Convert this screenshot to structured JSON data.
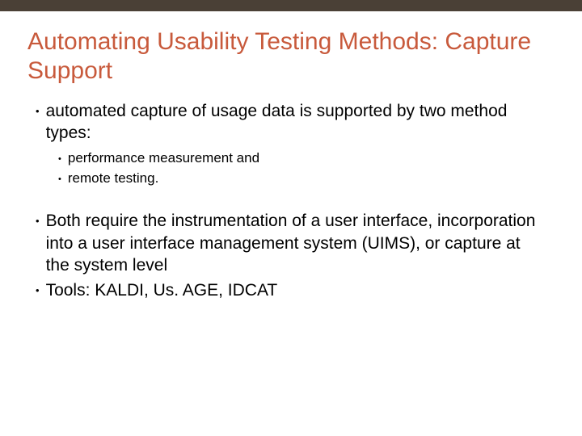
{
  "title": "Automating Usability Testing Methods: Capture Support",
  "bullets": {
    "b1": "automated capture of usage data is supported by two method types:",
    "b1a": "performance measurement and",
    "b1b": "remote testing.",
    "b2": "Both require the instrumentation of a user interface, incorporation into a user interface management system (UIMS), or capture at the system level",
    "b3": "Tools: KALDI, Us. AGE, IDCAT"
  }
}
